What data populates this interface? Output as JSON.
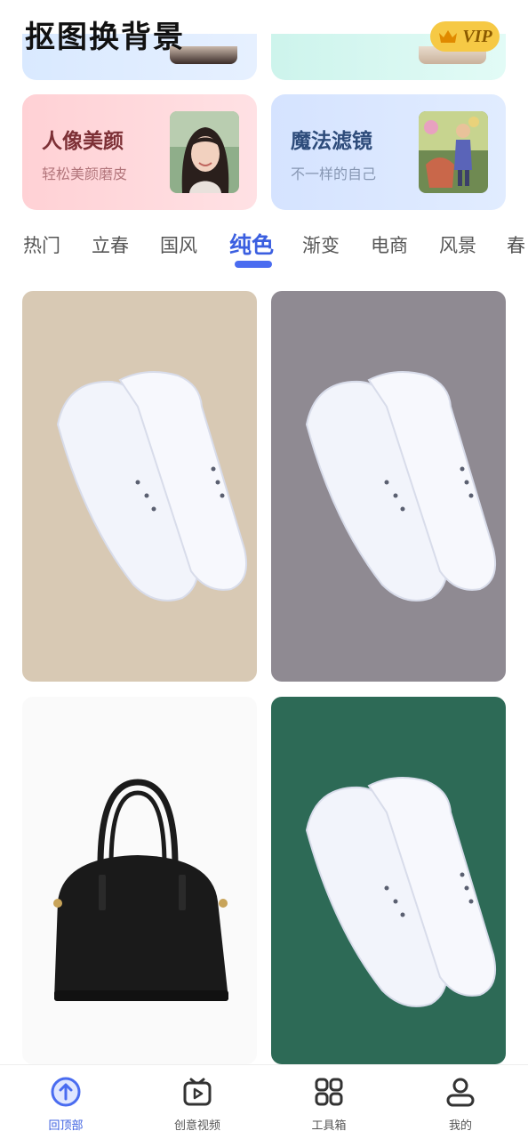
{
  "header": {
    "app_title": "抠图换背景",
    "vip_label": "VIP"
  },
  "feature_cards": [
    {
      "title": "人像美颜",
      "subtitle": "轻松美颜磨皮"
    },
    {
      "title": "魔法滤镜",
      "subtitle": "不一样的自己"
    }
  ],
  "tabs": [
    {
      "label": "热门"
    },
    {
      "label": "立春"
    },
    {
      "label": "国风"
    },
    {
      "label": "纯色",
      "active": true
    },
    {
      "label": "渐变"
    },
    {
      "label": "电商"
    },
    {
      "label": "风景"
    },
    {
      "label": "春"
    }
  ],
  "grid": {
    "items": [
      {
        "subject": "white sneakers",
        "background": "#d8c9b4"
      },
      {
        "subject": "white sneakers",
        "background": "#8f8a92"
      },
      {
        "subject": "black handbag",
        "background": "#fafafa"
      },
      {
        "subject": "white sneakers",
        "background": "#2d6a56"
      }
    ]
  },
  "bottom_nav": [
    {
      "label": "回顶部",
      "icon": "arrow-up-circle-icon",
      "active": true
    },
    {
      "label": "创意视频",
      "icon": "video-play-icon"
    },
    {
      "label": "工具箱",
      "icon": "grid-apps-icon"
    },
    {
      "label": "我的",
      "icon": "profile-icon"
    }
  ],
  "colors": {
    "accent": "#3b5fe0",
    "vip_gold": "#f6c945"
  }
}
